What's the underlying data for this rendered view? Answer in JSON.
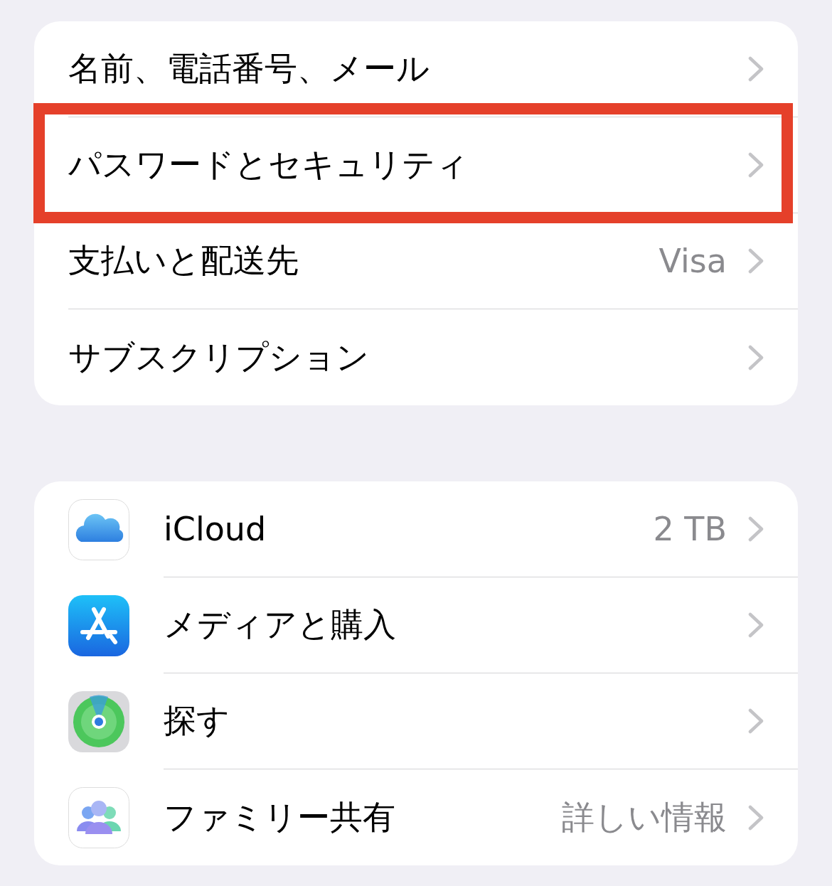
{
  "account_items": [
    {
      "label": "名前、電話番号、メール",
      "highlighted": false
    },
    {
      "label": "パスワードとセキュリティ",
      "highlighted": true
    },
    {
      "label": "支払いと配送先",
      "value": "Visa",
      "highlighted": false
    },
    {
      "label": "サブスクリプション",
      "highlighted": false
    }
  ],
  "service_items": [
    {
      "kind": "icloud",
      "label": "iCloud",
      "value": "2 TB"
    },
    {
      "kind": "media",
      "label": "メディアと購入"
    },
    {
      "kind": "findmy",
      "label": "探す"
    },
    {
      "kind": "family",
      "label": "ファミリー共有",
      "value": "詳しい情報"
    }
  ]
}
